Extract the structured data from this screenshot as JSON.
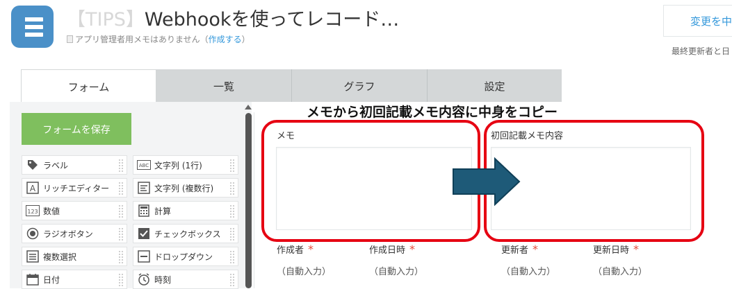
{
  "header": {
    "app_title_blurred": "【TIPS】",
    "app_title": "Webhookを使ってレコード…",
    "memo_text": "アプリ管理者用メモはありません（",
    "memo_link": "作成する",
    "memo_close": "）",
    "save_change_label": "変更を中",
    "last_updated_label": "最終更新者と日"
  },
  "tabs": [
    {
      "label": "フォーム",
      "active": true
    },
    {
      "label": "一覧",
      "active": false
    },
    {
      "label": "グラフ",
      "active": false
    },
    {
      "label": "設定",
      "active": false
    }
  ],
  "palette": {
    "save_form_label": "フォームを保存",
    "items": [
      {
        "label": "ラベル",
        "icon": "tag-icon"
      },
      {
        "label": "文字列 (1行)",
        "icon": "text-single-line-icon"
      },
      {
        "label": "リッチエディター",
        "icon": "rich-editor-icon"
      },
      {
        "label": "文字列 (複数行)",
        "icon": "text-multi-line-icon"
      },
      {
        "label": "数値",
        "icon": "number-icon"
      },
      {
        "label": "計算",
        "icon": "calculator-icon"
      },
      {
        "label": "ラジオボタン",
        "icon": "radio-icon"
      },
      {
        "label": "チェックボックス",
        "icon": "checkbox-icon"
      },
      {
        "label": "複数選択",
        "icon": "multi-select-icon"
      },
      {
        "label": "ドロップダウン",
        "icon": "dropdown-icon"
      },
      {
        "label": "日付",
        "icon": "calendar-icon"
      },
      {
        "label": "時刻",
        "icon": "clock-icon"
      }
    ]
  },
  "canvas": {
    "annotation": "メモから初回記載メモ内容に中身をコピー",
    "memo_label": "メモ",
    "initial_memo_label": "初回記載メモ内容",
    "creator_label": "作成者",
    "created_at_label": "作成日時",
    "updater_label": "更新者",
    "updated_at_label": "更新日時",
    "required_mark": "*",
    "auto_input": "（自動入力）"
  },
  "colors": {
    "accent": "#3498db",
    "save_green": "#7fbf5e",
    "highlight_red": "#e60012",
    "arrow": "#1e5a78",
    "app_icon": "#4a90c8"
  }
}
